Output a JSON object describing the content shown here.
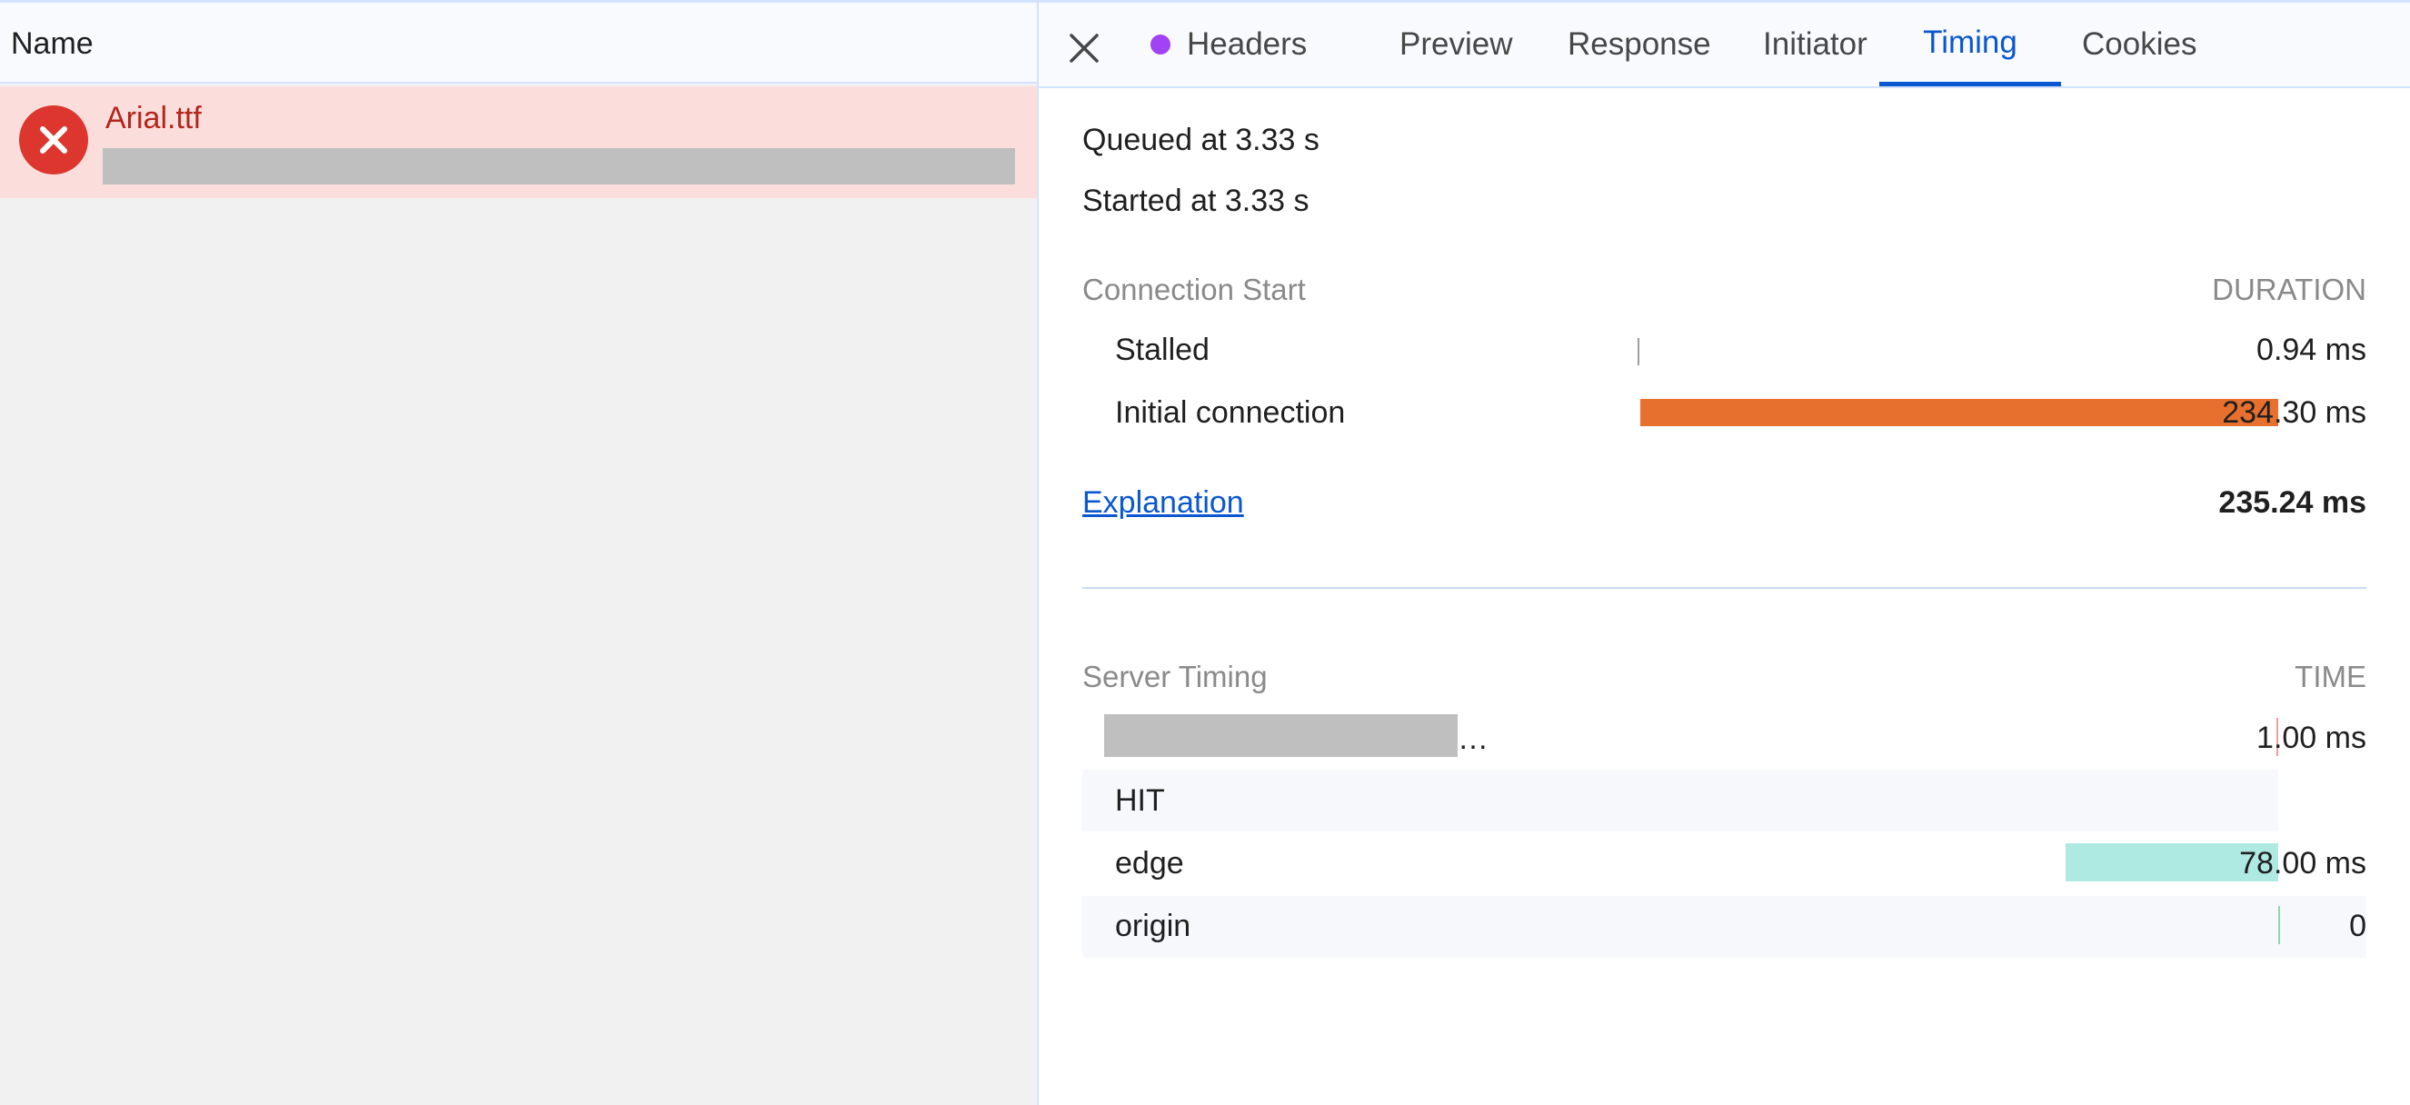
{
  "list": {
    "header_name": "Name",
    "request": {
      "name": "Arial.ttf",
      "status": "error"
    }
  },
  "tabs": {
    "items": [
      {
        "label": "Headers",
        "active": false,
        "dot_color": "#a142f4"
      },
      {
        "label": "Preview",
        "active": false
      },
      {
        "label": "Response",
        "active": false
      },
      {
        "label": "Initiator",
        "active": false
      },
      {
        "label": "Timing",
        "active": true
      },
      {
        "label": "Cookies",
        "active": false
      }
    ],
    "close_icon": "close-icon"
  },
  "timing": {
    "queued": "Queued at 3.33 s",
    "started": "Started at 3.33 s",
    "connection_start": {
      "heading": "Connection Start",
      "column": "DURATION",
      "rows": [
        {
          "label": "Stalled",
          "value": "0.94 ms",
          "color": "#9e9e9e"
        },
        {
          "label": "Initial connection",
          "value": "234.30 ms",
          "color": "#e8702e"
        }
      ]
    },
    "explanation_link": "Explanation",
    "total": "235.24 ms",
    "server_timing": {
      "heading": "Server Timing",
      "column": "TIME",
      "rows": [
        {
          "label": "…",
          "value": "1.00 ms",
          "color": "#e8a0a8"
        },
        {
          "label": "HIT",
          "value": ""
        },
        {
          "label": "edge",
          "value": "78.00 ms",
          "color": "#aeeae2"
        },
        {
          "label": "origin",
          "value": "0",
          "color": "#8fd9a8"
        }
      ]
    }
  },
  "colors": {
    "accent": "#0b57d0",
    "error": "#dc362e",
    "error_row_bg": "#fbdedc"
  }
}
